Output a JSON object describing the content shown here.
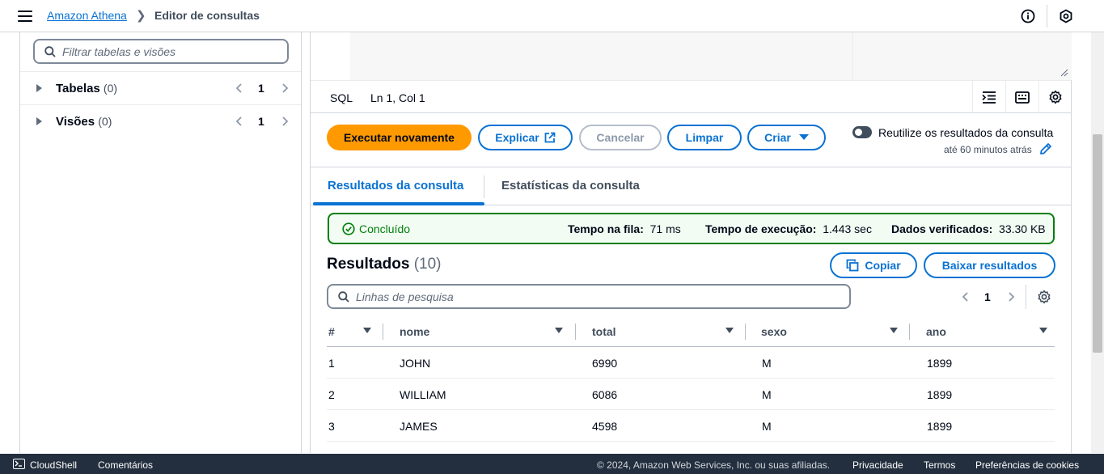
{
  "header": {
    "breadcrumb_service": "Amazon Athena",
    "breadcrumb_current": "Editor de consultas"
  },
  "left_panel": {
    "filter_placeholder": "Filtrar tabelas e visões",
    "groups": [
      {
        "label": "Tabelas",
        "count": "(0)",
        "page": "1"
      },
      {
        "label": "Visões",
        "count": "(0)",
        "page": "1"
      }
    ]
  },
  "editor": {
    "language": "SQL",
    "cursor": "Ln 1, Col 1"
  },
  "actions": {
    "run_again": "Executar novamente",
    "explain": "Explicar",
    "cancel": "Cancelar",
    "clear": "Limpar",
    "create": "Criar",
    "reuse_label": "Reutilize os resultados da consulta",
    "reuse_time": "até 60 minutos atrás"
  },
  "tabs": [
    {
      "label": "Resultados da consulta",
      "active": true
    },
    {
      "label": "Estatísticas da consulta",
      "active": false
    }
  ],
  "status": {
    "state": "Concluído",
    "queue_label": "Tempo na fila:",
    "queue_value": "71 ms",
    "exec_label": "Tempo de execução:",
    "exec_value": "1.443 sec",
    "scanned_label": "Dados verificados:",
    "scanned_value": "33.30 KB",
    "color": "#037f0c"
  },
  "results": {
    "title": "Resultados",
    "count": "(10)",
    "copy": "Copiar",
    "download": "Baixar resultados",
    "search_placeholder": "Linhas de pesquisa",
    "page": "1",
    "columns": [
      "#",
      "nome",
      "total",
      "sexo",
      "ano"
    ],
    "rows": [
      [
        "1",
        "JOHN",
        "6990",
        "M",
        "1899"
      ],
      [
        "2",
        "WILLIAM",
        "6086",
        "M",
        "1899"
      ],
      [
        "3",
        "JAMES",
        "4598",
        "M",
        "1899"
      ]
    ]
  },
  "footer": {
    "cloudshell": "CloudShell",
    "feedback": "Comentários",
    "copyright": "© 2024, Amazon Web Services, Inc. ou suas afiliadas.",
    "privacy": "Privacidade",
    "terms": "Termos",
    "cookies": "Preferências de cookies"
  },
  "colors": {
    "accent": "#0972d3",
    "primary_button": "#ff9900",
    "footer_bg": "#232f3e"
  }
}
